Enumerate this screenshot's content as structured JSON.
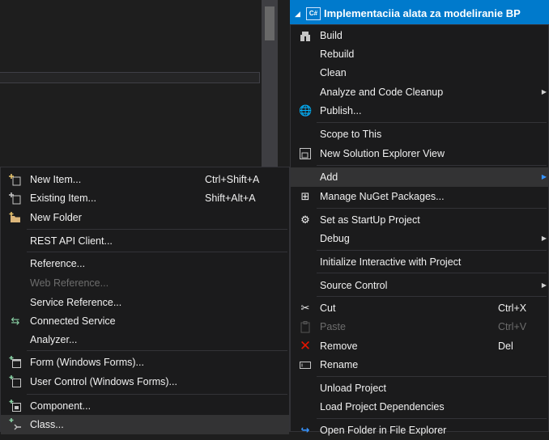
{
  "solution_explorer": {
    "project_name": "Implementaciia alata za modeliranie BP"
  },
  "context_menu": {
    "items": [
      {
        "label": "Build",
        "icon": "build-icon"
      },
      {
        "label": "Rebuild"
      },
      {
        "label": "Clean"
      },
      {
        "label": "Analyze and Code Cleanup",
        "submenu": true
      },
      {
        "label": "Publish...",
        "icon": "globe-icon"
      },
      {
        "label": "Scope to This"
      },
      {
        "label": "New Solution Explorer View",
        "icon": "new-view-icon"
      },
      {
        "label": "Add",
        "submenu": true
      },
      {
        "label": "Manage NuGet Packages...",
        "icon": "nuget-icon"
      },
      {
        "label": "Set as StartUp Project",
        "icon": "gear-icon"
      },
      {
        "label": "Debug",
        "submenu": true
      },
      {
        "label": "Initialize Interactive with Project"
      },
      {
        "label": "Source Control",
        "submenu": true
      },
      {
        "label": "Cut",
        "shortcut": "Ctrl+X",
        "icon": "scissors-icon"
      },
      {
        "label": "Paste",
        "shortcut": "Ctrl+V",
        "icon": "paste-icon",
        "disabled": true
      },
      {
        "label": "Remove",
        "shortcut": "Del",
        "icon": "remove-icon"
      },
      {
        "label": "Rename",
        "icon": "rename-icon"
      },
      {
        "label": "Unload Project"
      },
      {
        "label": "Load Project Dependencies"
      },
      {
        "label": "Open Folder in File Explorer",
        "icon": "open-folder-icon"
      }
    ]
  },
  "add_submenu": {
    "items": [
      {
        "label": "New Item...",
        "shortcut": "Ctrl+Shift+A",
        "icon": "new-item-icon"
      },
      {
        "label": "Existing Item...",
        "shortcut": "Shift+Alt+A",
        "icon": "existing-item-icon"
      },
      {
        "label": "New Folder",
        "icon": "new-folder-icon"
      },
      {
        "label": "REST API Client..."
      },
      {
        "label": "Reference..."
      },
      {
        "label": "Web Reference...",
        "disabled": true
      },
      {
        "label": "Service Reference..."
      },
      {
        "label": "Connected Service",
        "icon": "connected-service-icon"
      },
      {
        "label": "Analyzer..."
      },
      {
        "label": "Form (Windows Forms)...",
        "icon": "form-icon"
      },
      {
        "label": "User Control (Windows Forms)...",
        "icon": "user-control-icon"
      },
      {
        "label": "Component...",
        "icon": "component-icon"
      },
      {
        "label": "Class...",
        "icon": "class-icon"
      }
    ]
  },
  "colors": {
    "accent": "#007acc",
    "menu_bg": "#1b1b1c",
    "highlight": "#333334",
    "disabled": "#6d6d6d",
    "remove_red": "#e51400"
  }
}
